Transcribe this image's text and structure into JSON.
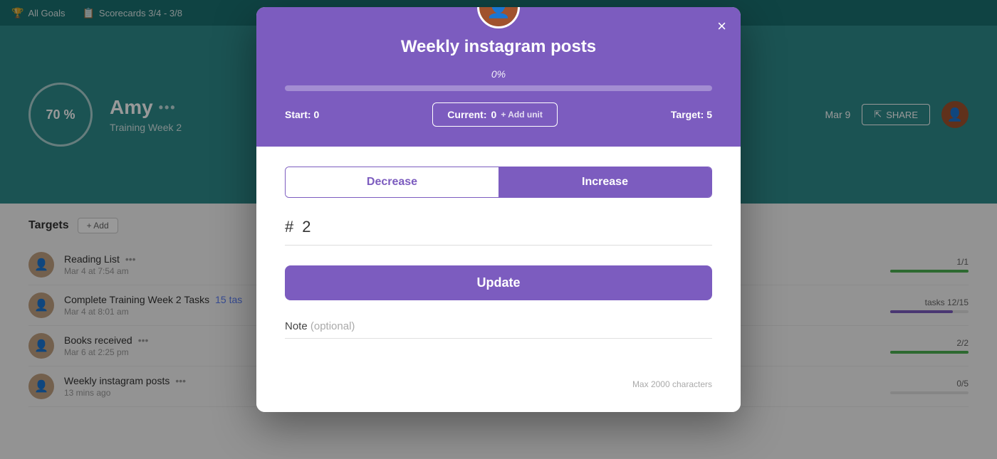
{
  "nav": {
    "all_goals_label": "All Goals",
    "scorecards_label": "Scorecards 3/4 - 3/8"
  },
  "header": {
    "percent": "70 %",
    "name": "Amy",
    "name_dots": "•••",
    "subtitle": "Training Week 2",
    "date": "Mar 9",
    "share_label": "SHARE"
  },
  "targets": {
    "title": "Targets",
    "add_label": "+ Add",
    "items": [
      {
        "name": "Reading List",
        "dots": "•••",
        "date": "Mar 4 at 7:54 am",
        "count": "1/1",
        "bar_pct": 100,
        "bar_color": "green"
      },
      {
        "name": "Complete Training Week 2 Tasks",
        "link": "15 tas",
        "date": "Mar 4 at 8:01 am",
        "count": "tasks 12/15",
        "bar_pct": 80,
        "bar_color": "purple"
      },
      {
        "name": "Books received",
        "dots": "•••",
        "date": "Mar 6 at 2:25 pm",
        "count": "2/2",
        "bar_pct": 100,
        "bar_color": "green"
      },
      {
        "name": "Weekly instagram posts",
        "dots": "•••",
        "date": "13 mins ago",
        "count": "0/5",
        "bar_pct": 0,
        "bar_color": "green"
      }
    ]
  },
  "modal": {
    "title": "Weekly instagram posts",
    "close_label": "×",
    "progress_percent": "0%",
    "start_label": "Start:",
    "start_value": "0",
    "current_label": "Current:",
    "current_value": "0",
    "add_unit_label": "+ Add unit",
    "target_label": "Target:",
    "target_value": "5",
    "decrease_label": "Decrease",
    "increase_label": "Increase",
    "number_hash": "#",
    "number_value": "2",
    "update_label": "Update",
    "note_label": "Note",
    "note_optional": "(optional)",
    "note_placeholder": "",
    "note_maxlength": "Max 2000 characters"
  }
}
